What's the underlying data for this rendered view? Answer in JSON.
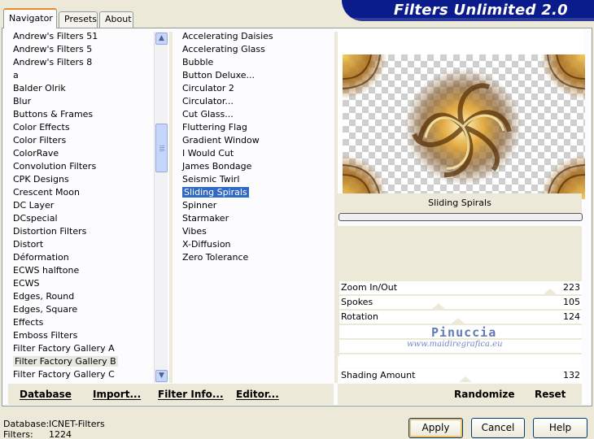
{
  "app": {
    "title": "Filters Unlimited 2.0"
  },
  "tabs": [
    {
      "label": "Navigator",
      "active": true
    },
    {
      "label": "Presets",
      "active": false
    },
    {
      "label": "About",
      "active": false
    }
  ],
  "categories": [
    "Andrew's Filters 51",
    "Andrew's Filters 5",
    "Andrew's Filters 8",
    "a",
    "Balder Olrik",
    "Blur",
    "Buttons & Frames",
    "Color Effects",
    "Color Filters",
    "ColorRave",
    "Convolution Filters",
    "CPK Designs",
    "Crescent Moon",
    "DC Layer",
    "DCspecial",
    "Distortion Filters",
    "Distort",
    "Déformation",
    "ECWS halftone",
    "ECWS",
    "Edges, Round",
    "Edges, Square",
    "Effects",
    "Emboss Filters",
    "Filter Factory Gallery A",
    "Filter Factory Gallery B",
    "Filter Factory Gallery C"
  ],
  "selected_category": "Filter Factory Gallery B",
  "filters": [
    "Accelerating Daisies",
    "Accelerating Glass",
    "Bubble",
    "Button Deluxe...",
    "Circulator 2",
    "Circulator...",
    "Cut Glass...",
    "Fluttering Flag",
    "Gradient Window",
    "I Would Cut",
    "James Bondage",
    "Seismic Twirl",
    "Sliding Spirals",
    "Spinner",
    "Starmaker",
    "Vibes",
    "X-Diffusion",
    "Zero Tolerance"
  ],
  "selected_filter": "Sliding Spirals",
  "preview": {
    "filter_name": "Sliding Spirals"
  },
  "params": [
    {
      "name": "Zoom In/Out",
      "value": "223",
      "level": 0.87
    },
    {
      "name": "Spokes",
      "value": "105",
      "level": 0.41
    },
    {
      "name": "Rotation",
      "value": "124",
      "level": 0.49
    },
    {
      "name": "",
      "value": ""
    },
    {
      "name": "",
      "value": ""
    },
    {
      "name": "",
      "value": ""
    },
    {
      "name": "Shading Amount",
      "value": "132",
      "level": 0.52
    }
  ],
  "watermark": {
    "line1": "Pinuccia",
    "line2": "www.maidiregrafica.eu"
  },
  "toolbar": {
    "database": "Database",
    "import": "Import...",
    "filter_info": "Filter Info...",
    "editor": "Editor...",
    "randomize": "Randomize",
    "reset": "Reset"
  },
  "footer": {
    "database_label": "Database:",
    "database_value": "ICNET-Filters",
    "filters_label": "Filters:",
    "filters_value": "1224",
    "apply": "Apply",
    "cancel": "Cancel",
    "help": "Help"
  },
  "colors": {
    "banner": "#0a1c8c",
    "selection": "#316ac5",
    "accent_tab": "#e68b2c"
  }
}
